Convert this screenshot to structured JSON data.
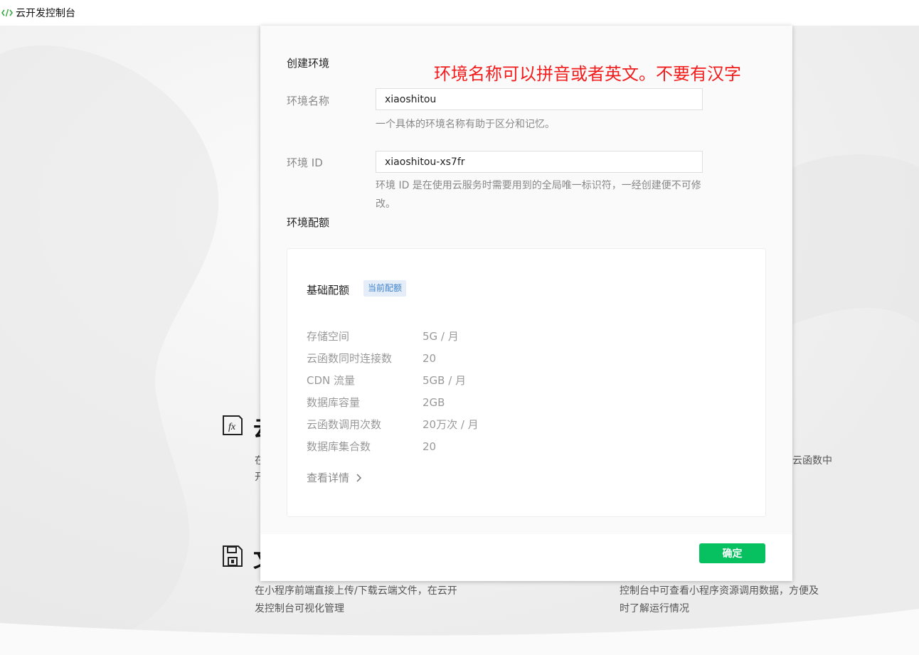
{
  "titlebar": {
    "title": "云开发控制台",
    "icon": "code-icon"
  },
  "background": {
    "feature1": {
      "icon": "fx-icon",
      "heading": "云",
      "text_line1": "在",
      "text_line2": "开"
    },
    "feature1_right": {
      "text": "云函数中"
    },
    "feature2": {
      "icon": "save-icon",
      "heading": "文",
      "text_line1": "在小程序前端直接上传/下载云端文件，在云开",
      "text_line2": "发控制台可视化管理"
    },
    "feature2_right": {
      "text_line1": "控制台中可查看小程序资源调用数据，方便及",
      "text_line2": "时了解运行情况"
    }
  },
  "modal": {
    "create_env_title": "创建环境",
    "annotation": "环境名称可以拼音或者英文。不要有汉字",
    "env_name": {
      "label": "环境名称",
      "value": "xiaoshitou",
      "hint": "一个具体的环境名称有助于区分和记忆。"
    },
    "env_id": {
      "label": "环境 ID",
      "value": "xiaoshitou-xs7fr",
      "hint_line1": "环境 ID 是在使用云服务时需要用到的全局唯一标识符，一经创建便不可修",
      "hint_line2": "改。"
    },
    "quota_title": "环境配额",
    "quota_card": {
      "title": "基础配额",
      "badge": "当前配额",
      "rows": [
        {
          "label": "存储空间",
          "value": "5G / 月"
        },
        {
          "label": "云函数同时连接数",
          "value": "20"
        },
        {
          "label": "CDN 流量",
          "value": "5GB / 月"
        },
        {
          "label": "数据库容量",
          "value": "2GB"
        },
        {
          "label": "云函数调用次数",
          "value": "20万次 / 月"
        },
        {
          "label": "数据库集合数",
          "value": "20"
        }
      ],
      "detail_link": "查看详情"
    },
    "confirm_button": "确定"
  },
  "colors": {
    "accent_green": "#07c160",
    "annotation_red": "#f21c1c",
    "badge_blue": "#3d82ca"
  }
}
